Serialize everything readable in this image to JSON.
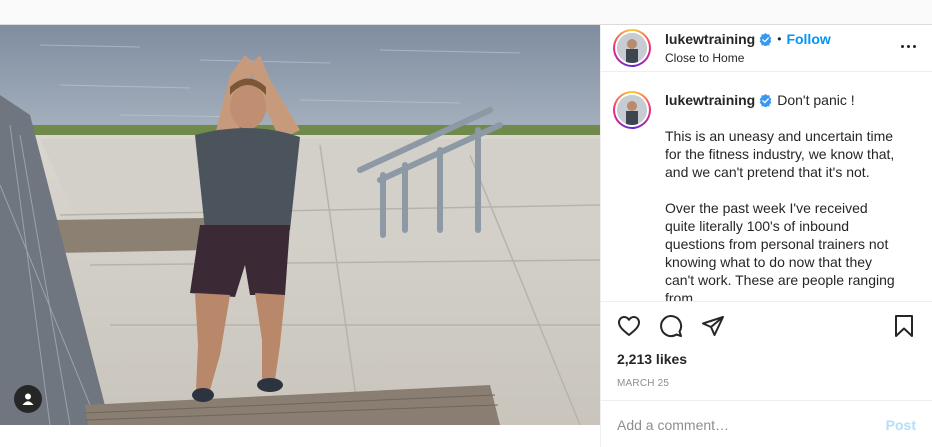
{
  "post": {
    "username": "lukewtraining",
    "follow_label": "Follow",
    "separator": "•",
    "location": "Close to Home",
    "caption": {
      "lead": "Don't panic !",
      "paragraphs": [
        "This is an uneasy and uncertain time for the fitness industry, we know that, and we can't pretend that it's not.",
        "Over the past week I've received quite literally 100's of inbound questions from personal trainers not knowing what to do now that they can't work. These are people ranging from"
      ]
    },
    "likes": "2,213 likes",
    "date": "MARCH 25",
    "comment_placeholder": "Add a comment…",
    "post_label": "Post"
  },
  "colors": {
    "accent": "#0095f6",
    "verified": "#3897f0",
    "post_disabled": "#b2dffc",
    "muted": "#8e8e8e"
  },
  "icons": {
    "verified": "verified-badge-icon",
    "more": "more-options-icon",
    "like": "heart-icon",
    "comment": "comment-bubble-icon",
    "share": "paper-plane-icon",
    "save": "bookmark-icon",
    "tag": "user-tag-icon"
  }
}
